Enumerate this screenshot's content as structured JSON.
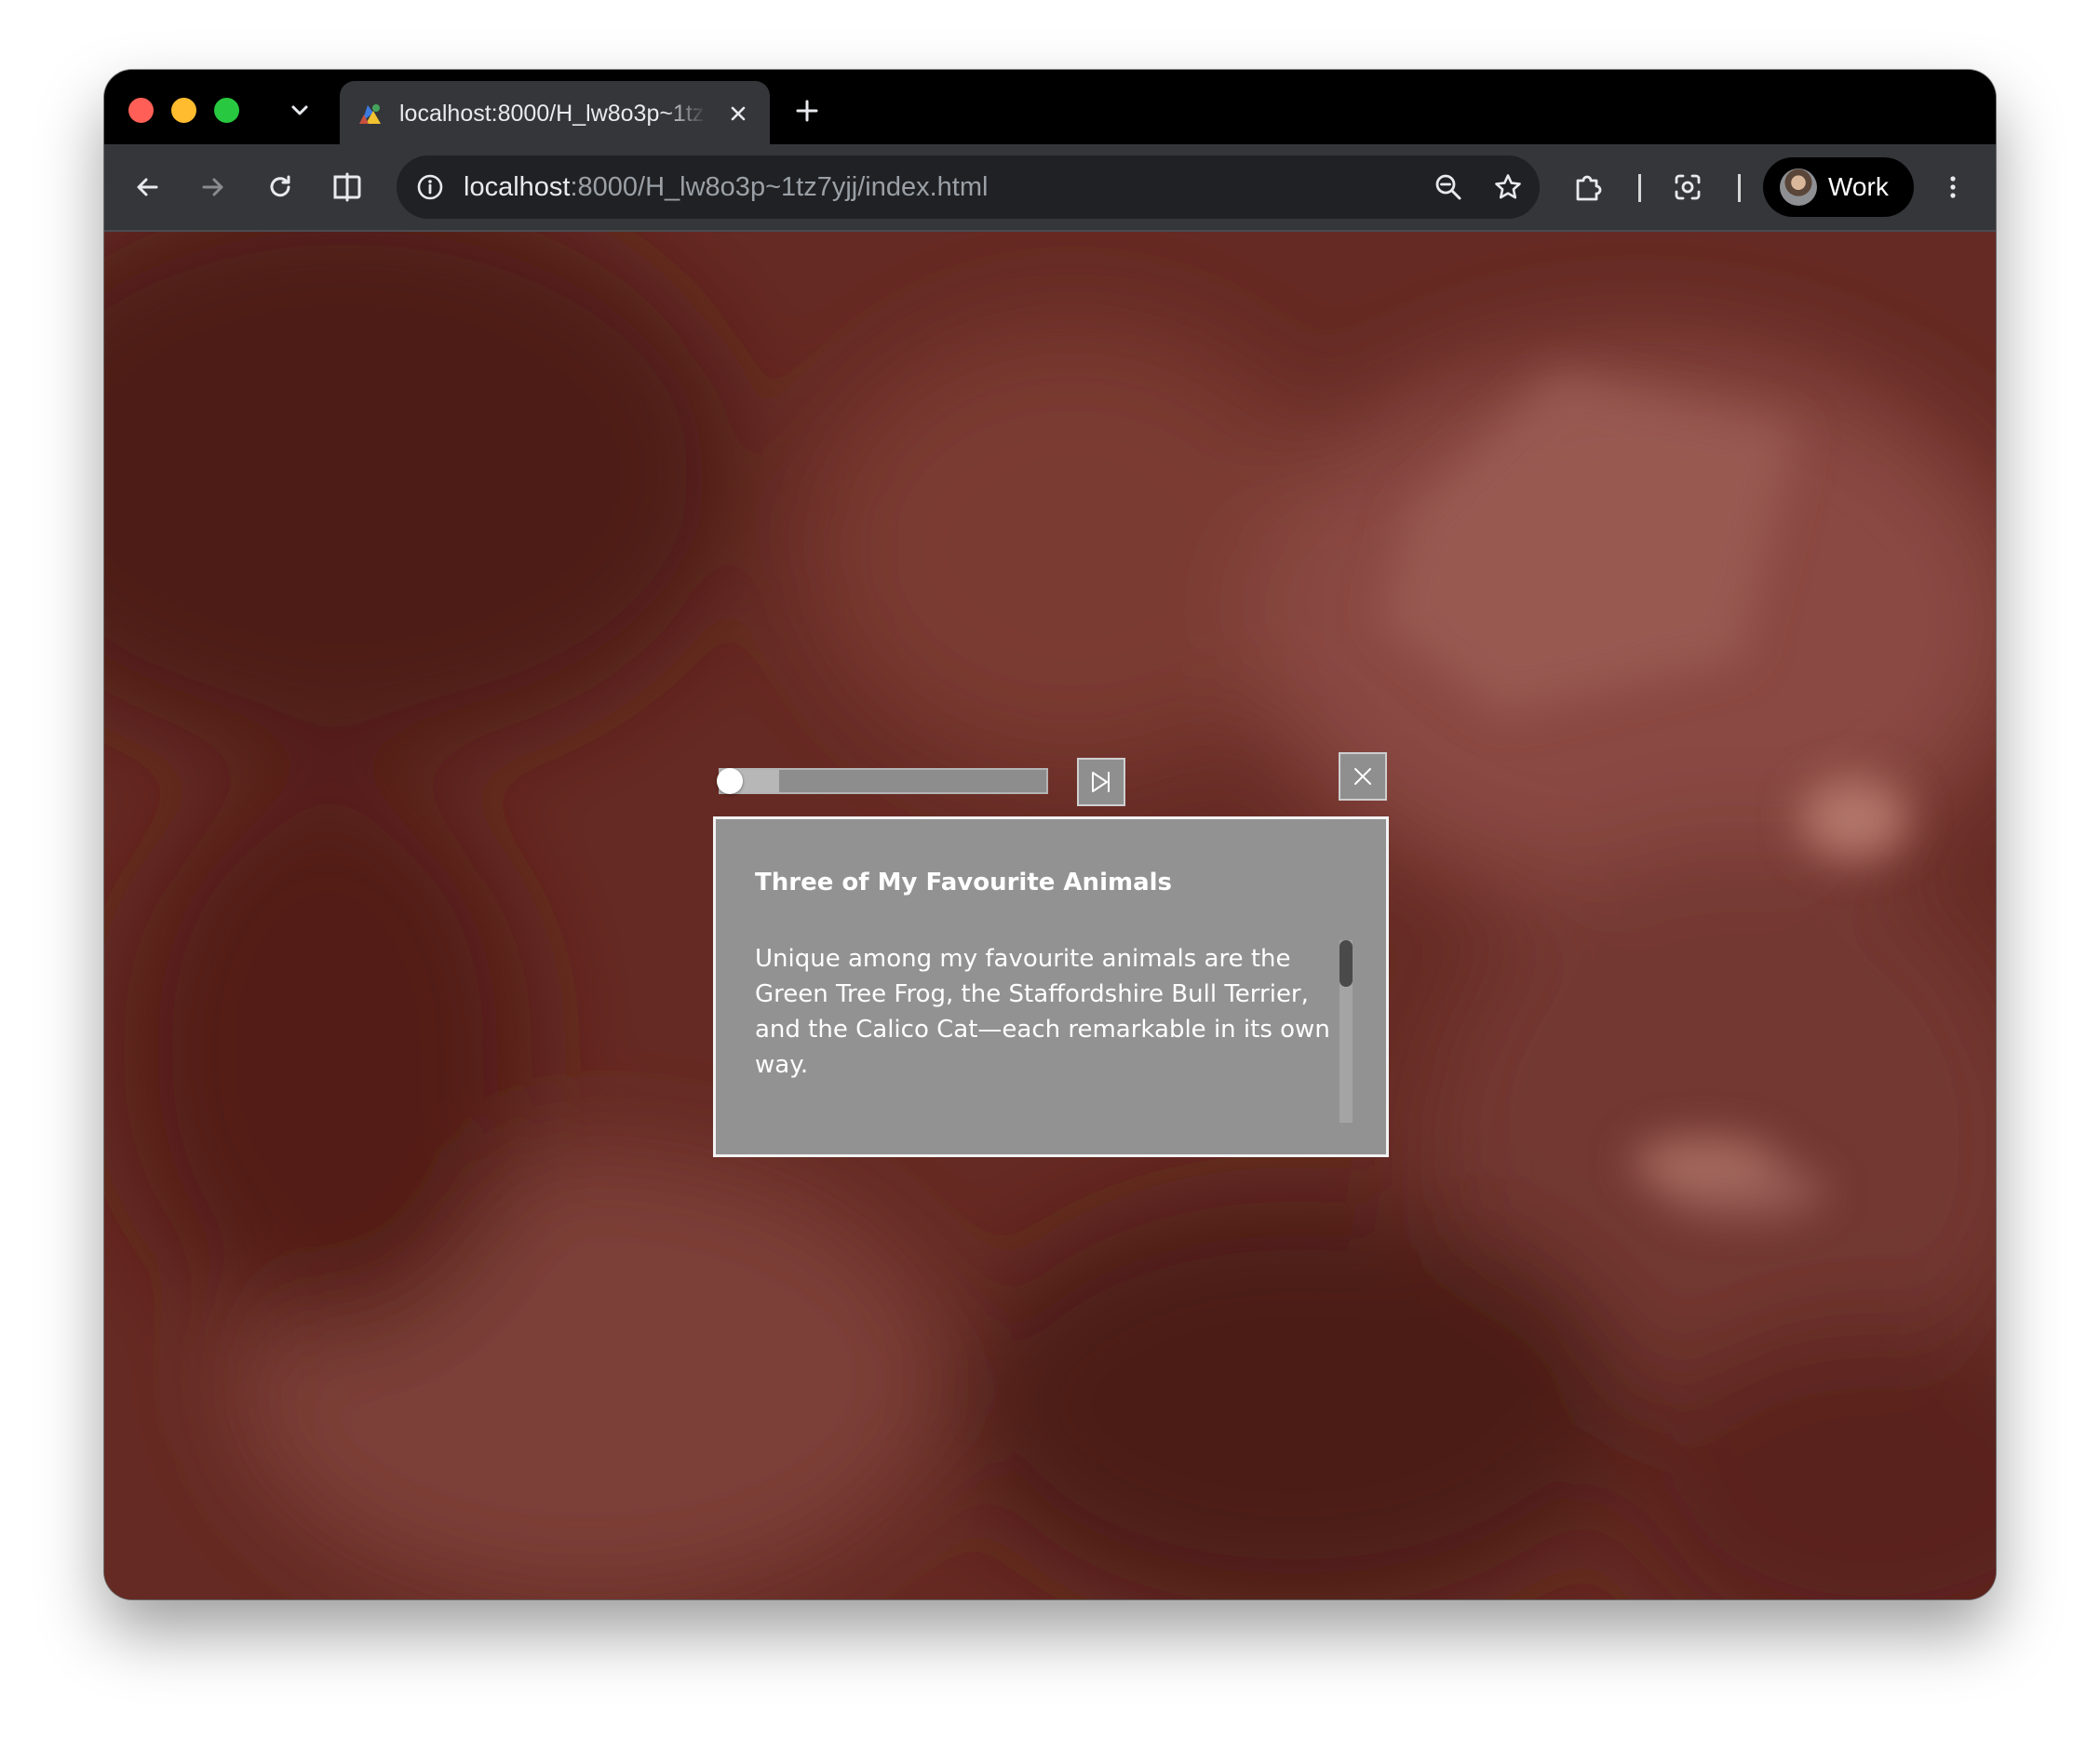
{
  "browser": {
    "tab": {
      "title": "localhost:8000/H_lw8o3p~1tz7yjj/index.html",
      "favicon": "colorful-app-favicon-icon"
    },
    "address_bar": {
      "host": "localhost",
      "path": ":8000/H_lw8o3p~1tz7yjj/index.html"
    },
    "profile": {
      "label": "Work"
    },
    "icons": {
      "tab_list": "chevron-down-icon",
      "tab_close": "close-icon",
      "new_tab": "plus-icon",
      "back": "arrow-left-icon",
      "forward": "arrow-right-icon",
      "reload": "reload-icon",
      "split_view": "split-view-icon",
      "site_info": "info-icon",
      "zoom": "zoom-out-icon",
      "bookmark": "star-icon",
      "extensions": "puzzle-icon",
      "screenshot": "screenshot-icon",
      "menu": "kebab-menu-icon"
    },
    "colors": {
      "close": "#ff5f57",
      "minimize": "#febc2e",
      "maximize": "#28c840"
    }
  },
  "player": {
    "progress": 0.18,
    "skip_icon": "skip-to-end-icon",
    "close_icon": "close-icon"
  },
  "dialog": {
    "title": "Three of My Favourite Animals",
    "body": "Unique among my favourite animals are the Green Tree Frog, the Staffordshire Bull Terrier, and the Calico Cat—each remarkable in its own way.",
    "scroll_position": 0
  }
}
